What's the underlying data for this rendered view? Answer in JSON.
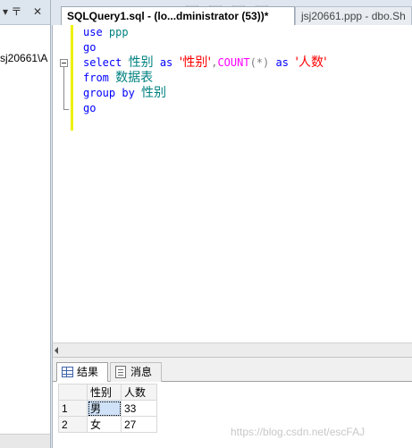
{
  "left_pane": {
    "pin_label": "▾ 〒",
    "close_label": "✕",
    "node_text": "sj20661\\A"
  },
  "tabs": {
    "active": "SQLQuery1.sql - (lo...dministrator (53))*",
    "inactive": "jsj20661.ppp - dbo.Sh"
  },
  "editor": {
    "lines": [
      {
        "t1": "use",
        "t2": "ppp"
      },
      {
        "t1": "go"
      },
      {
        "select": "select",
        "col": "性别",
        "as1": "as",
        "alias1": "'性别'",
        "comma": ",",
        "fn": "COUNT",
        "paren": "(*)",
        "as2": "as",
        "alias2": "'人数'"
      },
      {
        "t1": "from",
        "t2": "数据表"
      },
      {
        "t1": "group by",
        "t2": "性别"
      },
      {
        "t1": "go"
      }
    ]
  },
  "results": {
    "tab_results": "结果",
    "tab_messages": "消息",
    "columns": [
      "性别",
      "人数"
    ],
    "rows": [
      {
        "num": "1",
        "gender": "男",
        "count": "33"
      },
      {
        "num": "2",
        "gender": "女",
        "count": "27"
      }
    ]
  },
  "watermark": "https://blog.csdn.net/escFAJ"
}
